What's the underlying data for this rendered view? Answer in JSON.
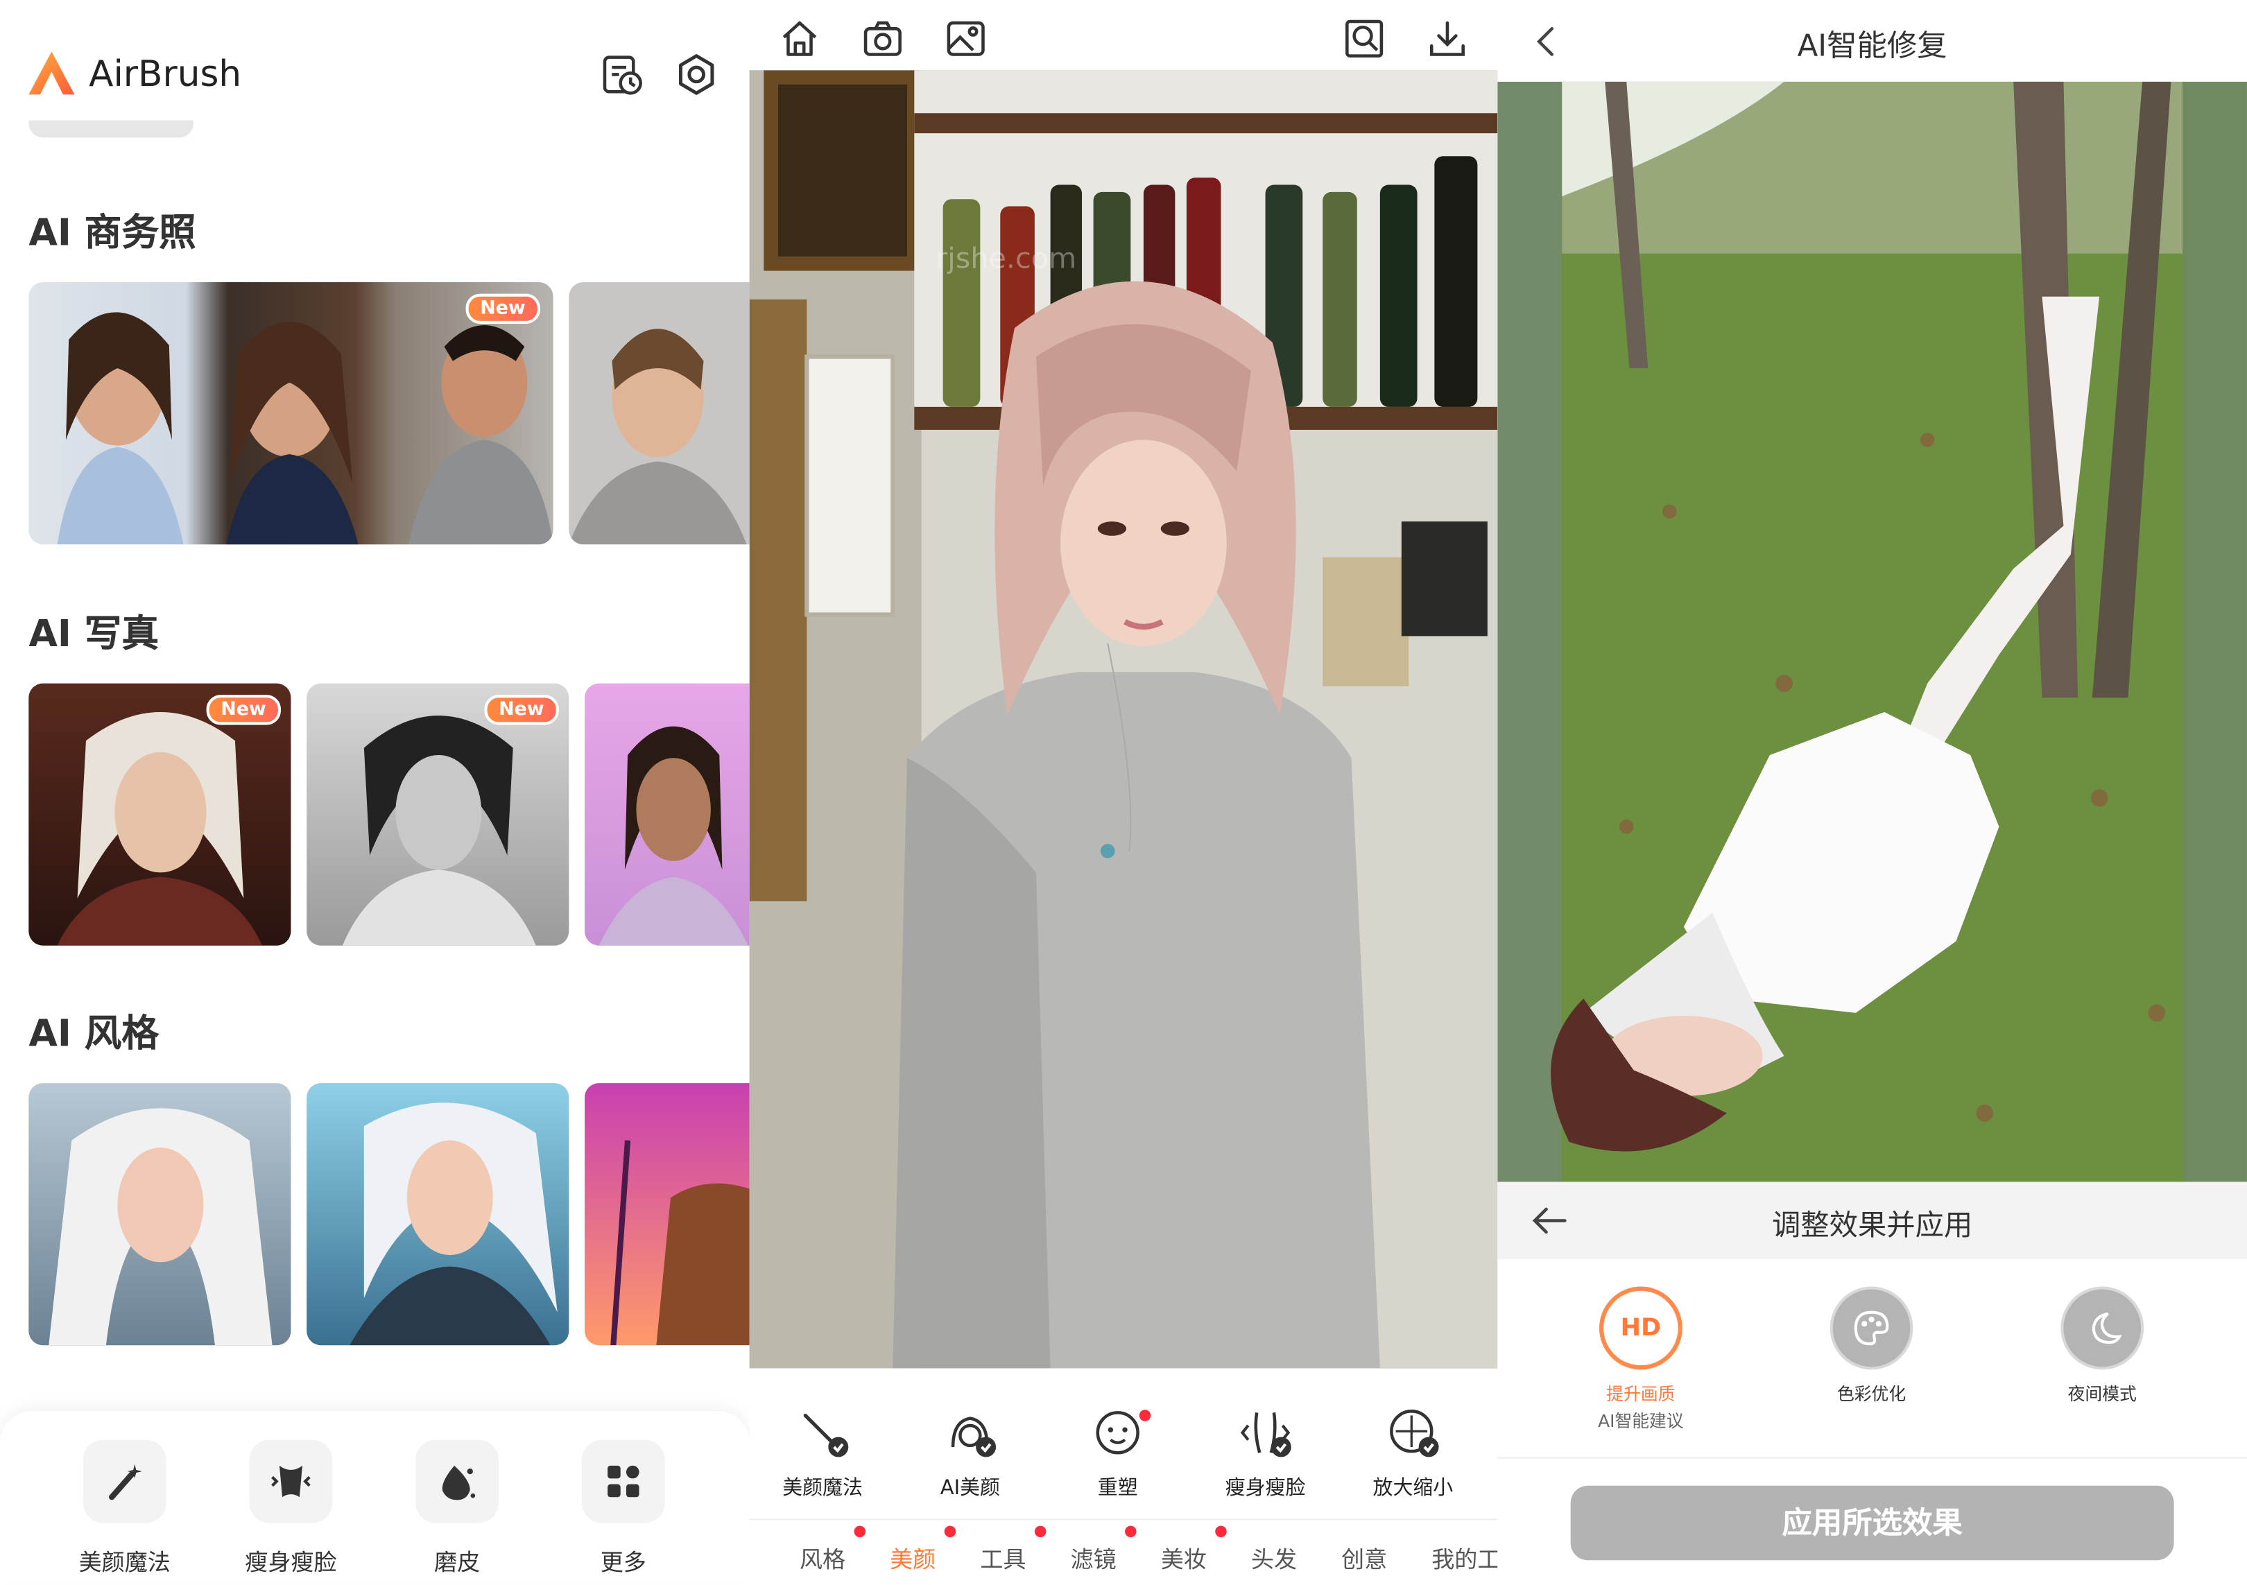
{
  "home": {
    "app_name": "AirBrush",
    "sections": [
      {
        "title": "AI 商务照"
      },
      {
        "title": "AI 写真"
      },
      {
        "title": "AI 风格"
      }
    ],
    "badge_new": "New",
    "dock": [
      {
        "label": "美颜魔法",
        "icon": "magic-wand-icon"
      },
      {
        "label": "瘦身瘦脸",
        "icon": "body-slim-icon"
      },
      {
        "label": "磨皮",
        "icon": "skin-smooth-icon"
      },
      {
        "label": "更多",
        "icon": "more-grid-icon"
      }
    ],
    "colors": {
      "accent": "#ff7a3a",
      "text": "#333333"
    }
  },
  "editor": {
    "watermark": "rjshe.com",
    "tools": [
      {
        "label": "美颜魔法",
        "icon": "magic-wand-icon"
      },
      {
        "label": "AI美颜",
        "icon": "ai-beauty-icon"
      },
      {
        "label": "重塑",
        "icon": "face-reshape-icon"
      },
      {
        "label": "瘦身瘦脸",
        "icon": "body-slim-icon"
      },
      {
        "label": "放大缩小",
        "icon": "zoom-resize-icon"
      }
    ],
    "tabs": [
      {
        "label": "风格",
        "active": false
      },
      {
        "label": "美颜",
        "active": true
      },
      {
        "label": "工具",
        "active": false
      },
      {
        "label": "滤镜",
        "active": false
      },
      {
        "label": "美妆",
        "active": false
      },
      {
        "label": "头发",
        "active": false
      },
      {
        "label": "创意",
        "active": false
      },
      {
        "label": "我的工",
        "active": false
      }
    ]
  },
  "repair": {
    "title": "AI智能修复",
    "adjust_title": "调整效果并应用",
    "options": [
      {
        "label": "提升画质",
        "sub": "AI智能建议",
        "icon_text": "HD",
        "selected": true
      },
      {
        "label": "色彩优化",
        "sub": "",
        "icon": "palette-icon",
        "selected": false
      },
      {
        "label": "夜间模式",
        "sub": "",
        "icon": "night-moon-icon",
        "selected": false
      }
    ],
    "apply_button": "应用所选效果"
  }
}
